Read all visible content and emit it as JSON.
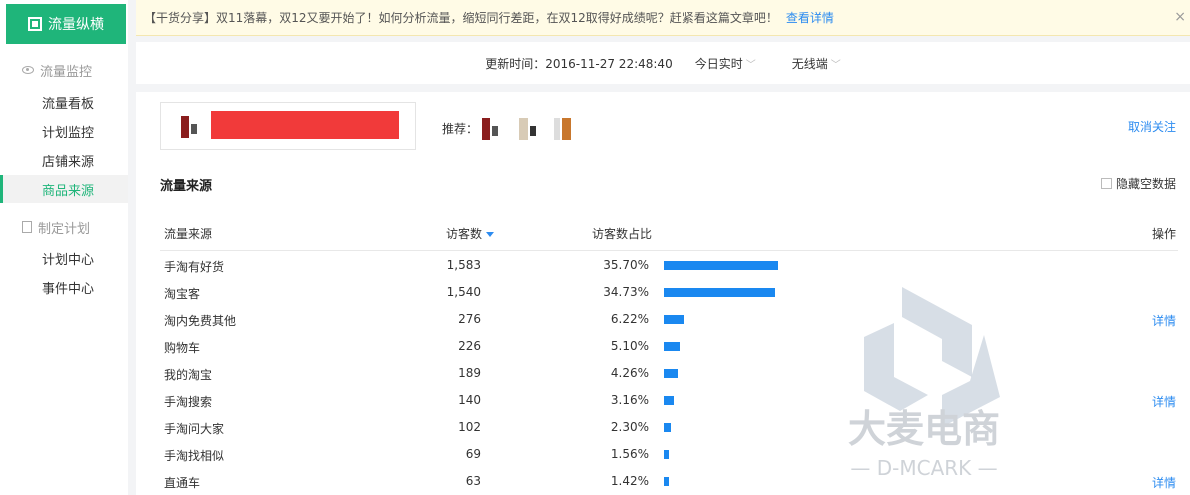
{
  "sidebar": {
    "logo": "流量纵横",
    "group1": "流量监控",
    "items1": [
      "流量看板",
      "计划监控",
      "店铺来源",
      "商品来源"
    ],
    "group2": "制定计划",
    "items2": [
      "计划中心",
      "事件中心"
    ]
  },
  "banner": {
    "text": "【干货分享】双11落幕，双12又要开始了！如何分析流量，缩短同行差距，在双12取得好成绩呢？赶紧看这篇文章吧！",
    "link": "查看详情",
    "close": "×"
  },
  "update_bar": {
    "time": "更新时间：2016-11-27 22:48:40",
    "period": "今日实时",
    "device": "无线端"
  },
  "item": {
    "rec_label": "推荐：",
    "unfollow": "取消关注"
  },
  "section": {
    "title": "流量来源",
    "hide_empty": "隐藏空数据"
  },
  "table": {
    "headers": {
      "source": "流量来源",
      "visitors": "访客数",
      "share": "访客数占比",
      "action": "操作"
    },
    "rows": [
      {
        "source": "手淘有好货",
        "visitors": "1,583",
        "share": "35.70%",
        "fraction": 0.357,
        "detail": ""
      },
      {
        "source": "淘宝客",
        "visitors": "1,540",
        "share": "34.73%",
        "fraction": 0.3473,
        "detail": ""
      },
      {
        "source": "淘内免费其他",
        "visitors": "276",
        "share": "6.22%",
        "fraction": 0.0622,
        "detail": "详情"
      },
      {
        "source": "购物车",
        "visitors": "226",
        "share": "5.10%",
        "fraction": 0.051,
        "detail": ""
      },
      {
        "source": "我的淘宝",
        "visitors": "189",
        "share": "4.26%",
        "fraction": 0.0426,
        "detail": ""
      },
      {
        "source": "手淘搜索",
        "visitors": "140",
        "share": "3.16%",
        "fraction": 0.0316,
        "detail": "详情"
      },
      {
        "source": "手淘问大家",
        "visitors": "102",
        "share": "2.30%",
        "fraction": 0.023,
        "detail": ""
      },
      {
        "source": "手淘找相似",
        "visitors": "69",
        "share": "1.56%",
        "fraction": 0.0156,
        "detail": ""
      },
      {
        "source": "直通车",
        "visitors": "63",
        "share": "1.42%",
        "fraction": 0.0142,
        "detail": "详情"
      }
    ]
  },
  "watermark": {
    "cn": "大麦电商",
    "en": "— D-MCARK —"
  },
  "colors": {
    "accent": "#1fb57a",
    "link": "#2d8cf0",
    "bar": "#1a88f0",
    "redact": "#f13a3a"
  }
}
